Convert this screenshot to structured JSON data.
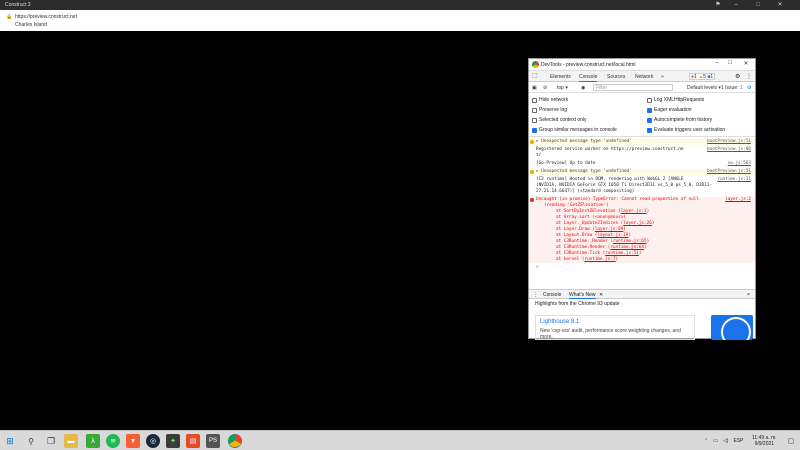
{
  "window": {
    "title": "Construct 3"
  },
  "page": {
    "url": "https://preview.construct.net",
    "title": "Charles Island"
  },
  "devtools": {
    "title": "DevTools - preview.construct.net/local.html",
    "tabs": [
      "Elements",
      "Console",
      "Sources",
      "Network",
      "»"
    ],
    "error_count": "1",
    "warn_count": "5",
    "info_count": "1",
    "toolbar": {
      "context": "top",
      "filter_placeholder": "Filter",
      "levels": "Default levels",
      "issues": "1 Issue:",
      "issues_count": "1"
    },
    "settings": {
      "left": [
        {
          "label": "Hide network",
          "checked": false
        },
        {
          "label": "Preserve log",
          "checked": false
        },
        {
          "label": "Selected context only",
          "checked": false
        },
        {
          "label": "Group similar messages in console",
          "checked": true
        }
      ],
      "right": [
        {
          "label": "Log XMLHttpRequests",
          "checked": false
        },
        {
          "label": "Eager evaluation",
          "checked": true
        },
        {
          "label": "Autocomplete from history",
          "checked": true
        },
        {
          "label": "Evaluate triggers user activation",
          "checked": true
        }
      ]
    },
    "console": {
      "warn1": {
        "text": "▸ Unexpected message type 'undefined'",
        "src": "bootPreview.js:51"
      },
      "info1": {
        "text": "Registered service worker on https://preview.construct.ne",
        "text2": "t/",
        "src": "bootPreview.js:80"
      },
      "info2": {
        "text": "[Go-Preview] Up to date",
        "src": "sw.js:563"
      },
      "warn2": {
        "text": "▸ Unexpected message type 'undefined'",
        "src": "bootPreview.js:51"
      },
      "info3": {
        "text": "[C3 runtime] Hosted in DOM, rendering with WebGL 2 [ANGLE",
        "text2": "(NVIDIA, NVIDIA GeForce GTX 1050 Ti Direct3D11 vs_5_0 ps_5_0, D3D11-",
        "text3": "27.21.14.6647)] (standard compositing)",
        "src": "runtime.js:21"
      },
      "error": {
        "text": "Uncaught (in promise) TypeError: Cannot read properties of null",
        "text2": "(reading 'GetZElevation')",
        "src": "layer.js:2",
        "stack": [
          {
            "fn": "at SortByInstZElevation",
            "loc": "layer.js:1"
          },
          {
            "fn": "at Array.sort",
            "loc": "<anonymous>"
          },
          {
            "fn": "at Layer._UpdateZIndices",
            "loc": "layer.js:26"
          },
          {
            "fn": "at Layer.Draw",
            "loc": "layer.js:89"
          },
          {
            "fn": "at Layout.Draw",
            "loc": "layout.js:19"
          },
          {
            "fn": "at C3Runtime._Render",
            "loc": "runtime.js:65"
          },
          {
            "fn": "at C3Runtime.Render",
            "loc": "runtime.js:64"
          },
          {
            "fn": "at C3Runtime.Tick",
            "loc": "runtime.js:51"
          },
          {
            "fn": "at kernel",
            "loc": "runtime.js:7"
          }
        ]
      },
      "prompt": ">"
    },
    "drawer": {
      "tabs": [
        "Console",
        "What's New"
      ],
      "close": "×",
      "heading": "Highlights from the Chrome 93 update",
      "card_title": "Lighthouse 8.1",
      "card_body": "New 'csp-xss' audit, performance score weighting changes, and more."
    }
  },
  "taskbar": {
    "language": "ESP",
    "time": "11:49 a. m.",
    "date": "9/9/2021"
  }
}
